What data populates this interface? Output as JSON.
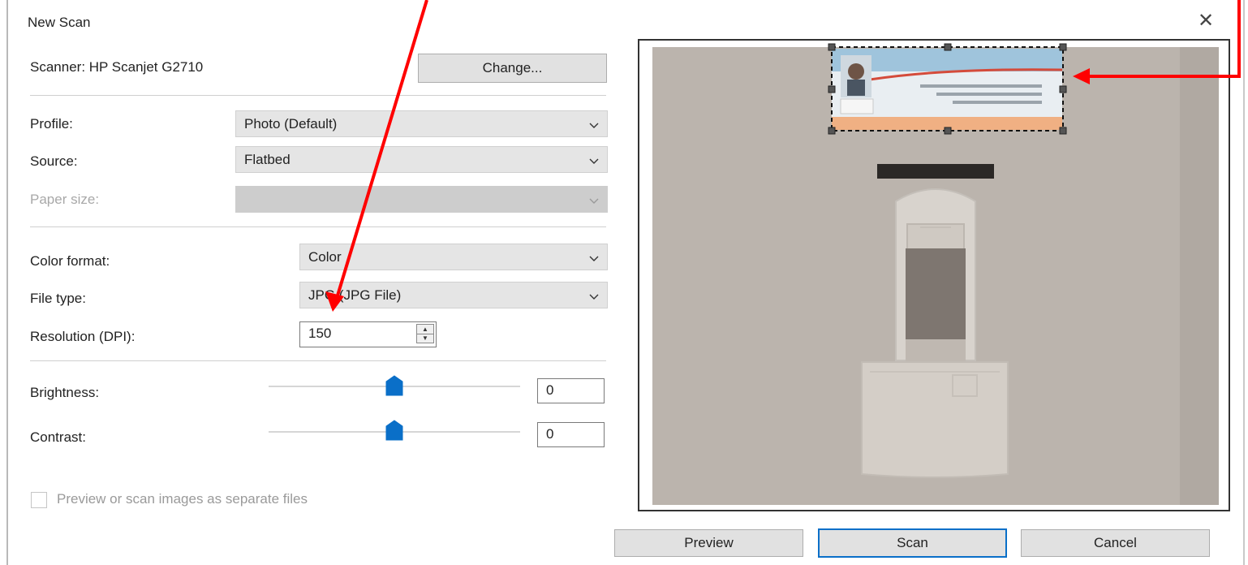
{
  "window": {
    "title": "New Scan",
    "close_glyph": "✕"
  },
  "scanner": {
    "label": "Scanner: HP Scanjet G2710",
    "change_button": "Change..."
  },
  "profile": {
    "label": "Profile:",
    "value": "Photo (Default)"
  },
  "source": {
    "label": "Source:",
    "value": "Flatbed"
  },
  "paper_size": {
    "label": "Paper size:",
    "value": "",
    "enabled": false
  },
  "color_format": {
    "label": "Color format:",
    "value": "Color"
  },
  "file_type": {
    "label": "File type:",
    "value": "JPG (JPG File)"
  },
  "resolution": {
    "label": "Resolution (DPI):",
    "value": "150"
  },
  "brightness": {
    "label": "Brightness:",
    "value": "0",
    "level": 0.5
  },
  "contrast": {
    "label": "Contrast:",
    "value": "0",
    "level": 0.5
  },
  "separate_files": {
    "label": "Preview or scan images as separate files",
    "checked": false
  },
  "buttons": {
    "preview": "Preview",
    "scan": "Scan",
    "cancel": "Cancel"
  },
  "colors": {
    "accent": "#0a6fc8",
    "arrow": "#ff0000"
  }
}
